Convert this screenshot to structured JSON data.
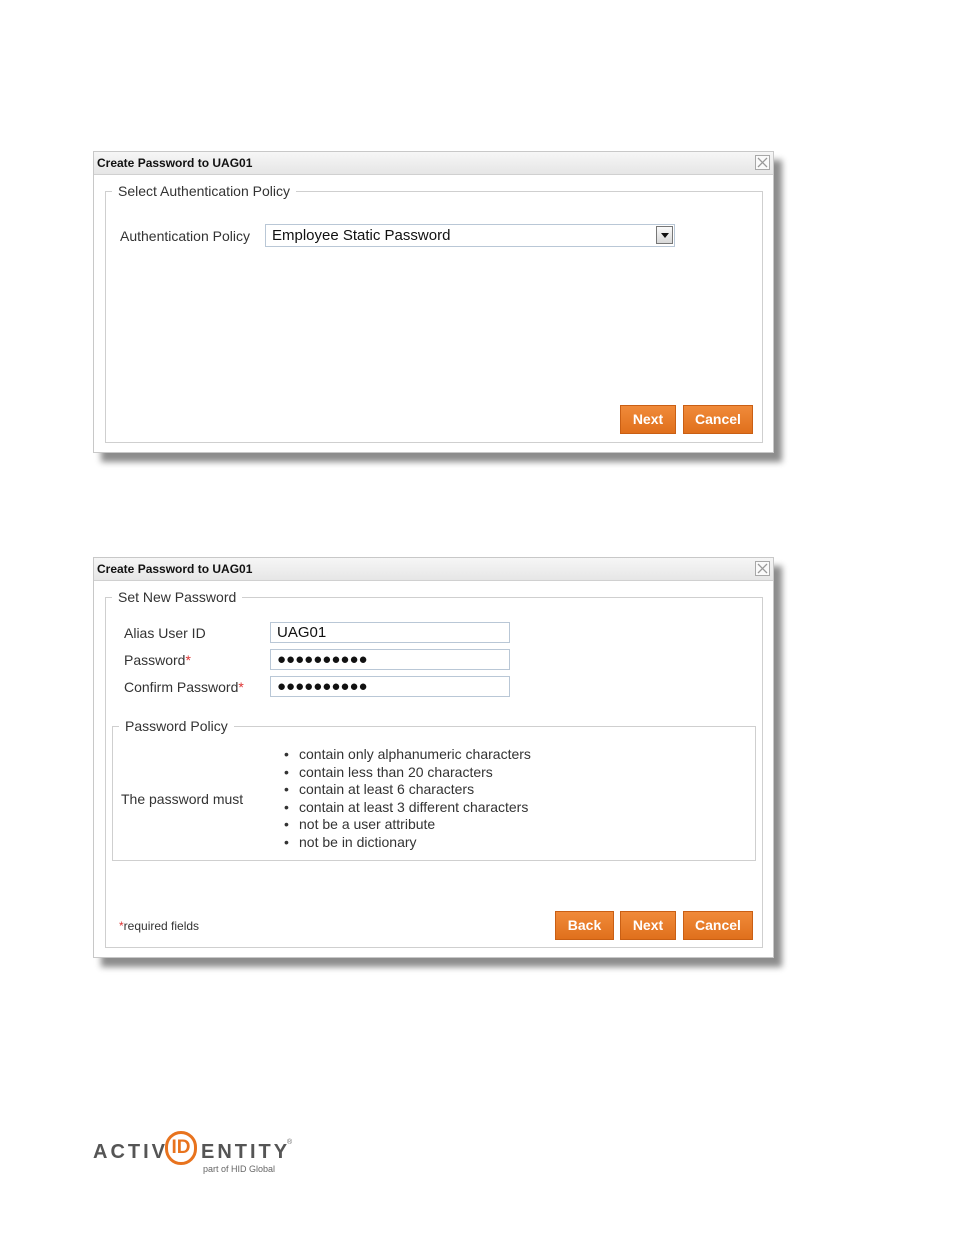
{
  "dialog1": {
    "title": "Create Password to UAG01",
    "fieldset_legend": "Select Authentication Policy",
    "policy_label": "Authentication Policy",
    "policy_value": "Employee Static Password",
    "next_label": "Next",
    "cancel_label": "Cancel"
  },
  "dialog2": {
    "title": "Create Password to UAG01",
    "fieldset_legend": "Set New Password",
    "alias_label": "Alias User ID",
    "alias_value": "UAG01",
    "password_label": "Password",
    "password_value": "●●●●●●●●●●",
    "confirm_label": "Confirm Password",
    "confirm_value": "●●●●●●●●●●",
    "required_mark": "*",
    "policy_legend": "Password Policy",
    "policy_intro": "The password must",
    "policy_rules": [
      "contain only alphanumeric characters",
      "contain less than 20 characters",
      "contain at least 6 characters",
      "contain at least 3 different characters",
      "not be a user attribute",
      "not be in dictionary"
    ],
    "required_note": "required fields",
    "back_label": "Back",
    "next_label": "Next",
    "cancel_label": "Cancel"
  },
  "logo": {
    "word_left": "ACTIV",
    "word_id": "ID",
    "word_right": "ENTITY",
    "registered": "®",
    "tagline": "part of HID Global"
  },
  "colors": {
    "button_orange": "#e8731e",
    "required_red": "#dd3333"
  }
}
